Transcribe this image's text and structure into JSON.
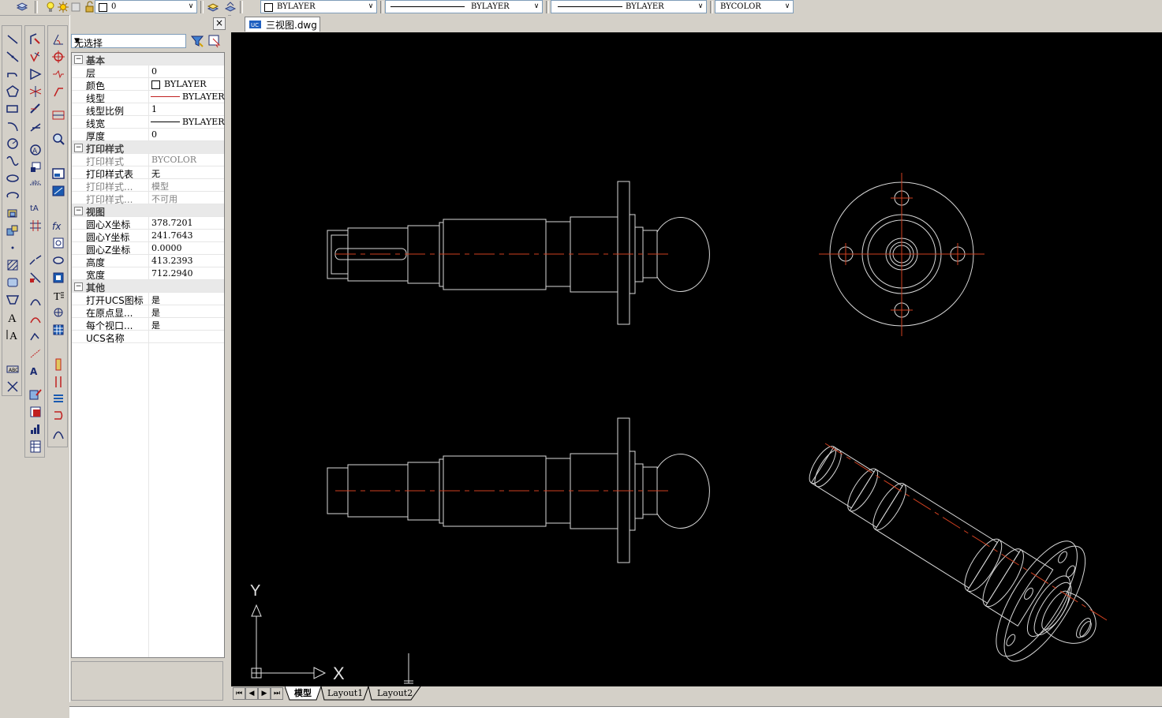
{
  "toolbar": {
    "layer_value": "0",
    "color_value": "BYLAYER",
    "linetype_value": "BYLAYER",
    "lineweight_value": "BYLAYER",
    "plotstyle_value": "BYCOLOR"
  },
  "properties": {
    "selection": "无选择",
    "close_symbol": "×",
    "categories": [
      {
        "label": "基本",
        "rows": [
          {
            "name": "层",
            "value": "0"
          },
          {
            "name": "颜色",
            "value": "BYLAYER"
          },
          {
            "name": "线型",
            "value": "BYLAYER"
          },
          {
            "name": "线型比例",
            "value": "1"
          },
          {
            "name": "线宽",
            "value": "BYLAYER"
          },
          {
            "name": "厚度",
            "value": "0"
          }
        ]
      },
      {
        "label": "打印样式",
        "rows": [
          {
            "name": "打印样式",
            "value": "BYCOLOR"
          },
          {
            "name": "打印样式表",
            "value": "无"
          },
          {
            "name": "打印样式...",
            "value": "模型"
          },
          {
            "name": "打印样式...",
            "value": "不可用"
          }
        ]
      },
      {
        "label": "视图",
        "rows": [
          {
            "name": "圆心X坐标",
            "value": "378.7201"
          },
          {
            "name": "圆心Y坐标",
            "value": "241.7643"
          },
          {
            "name": "圆心Z坐标",
            "value": "0.0000"
          },
          {
            "name": "高度",
            "value": "413.2393"
          },
          {
            "name": "宽度",
            "value": "712.2940"
          }
        ]
      },
      {
        "label": "其他",
        "rows": [
          {
            "name": "打开UCS图标",
            "value": "是"
          },
          {
            "name": "在原点显...",
            "value": "是"
          },
          {
            "name": "每个视口...",
            "value": "是"
          },
          {
            "name": "UCS名称",
            "value": ""
          }
        ]
      }
    ]
  },
  "document": {
    "tab_title": "三视图.dwg"
  },
  "ucs": {
    "x_label": "X",
    "y_label": "Y"
  },
  "layout_tabs": [
    "模型",
    "Layout1",
    "Layout2"
  ],
  "colors": {
    "drawing_line": "#d8d8d8",
    "center_line": "#d04020",
    "canvas": "#000000"
  }
}
